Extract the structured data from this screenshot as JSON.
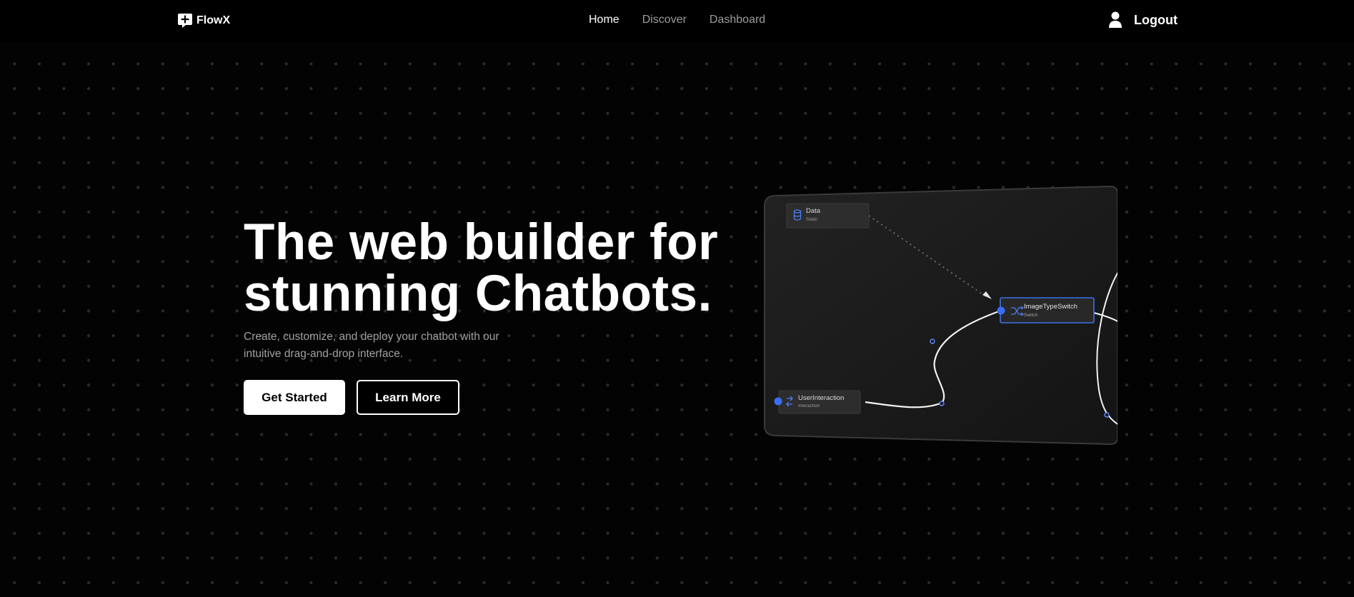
{
  "brand": {
    "name": "FlowX"
  },
  "nav": {
    "links": [
      {
        "label": "Home",
        "active": true
      },
      {
        "label": "Discover",
        "active": false
      },
      {
        "label": "Dashboard",
        "active": false
      }
    ],
    "logout_label": "Logout"
  },
  "hero": {
    "title_line1": "The web builder for",
    "title_line2": "stunning Chatbots.",
    "subtitle": "Create, customize, and deploy your chatbot with our intuitive drag-and-drop interface.",
    "primary_button": "Get Started",
    "secondary_button": "Learn More"
  },
  "flow_preview": {
    "nodes": [
      {
        "title": "Data",
        "subtitle": "Static",
        "icon": "database-icon"
      },
      {
        "title": "ImageTypeSwitch",
        "subtitle": "Switch",
        "icon": "shuffle-icon",
        "selected": true
      },
      {
        "title": "UserInteraction",
        "subtitle": "Interaction",
        "icon": "interaction-icon"
      }
    ]
  },
  "colors": {
    "background": "#000000",
    "accent": "#3b6cf5",
    "muted_text": "#a1a1a1",
    "dot_grid": "#2b2b2b"
  }
}
